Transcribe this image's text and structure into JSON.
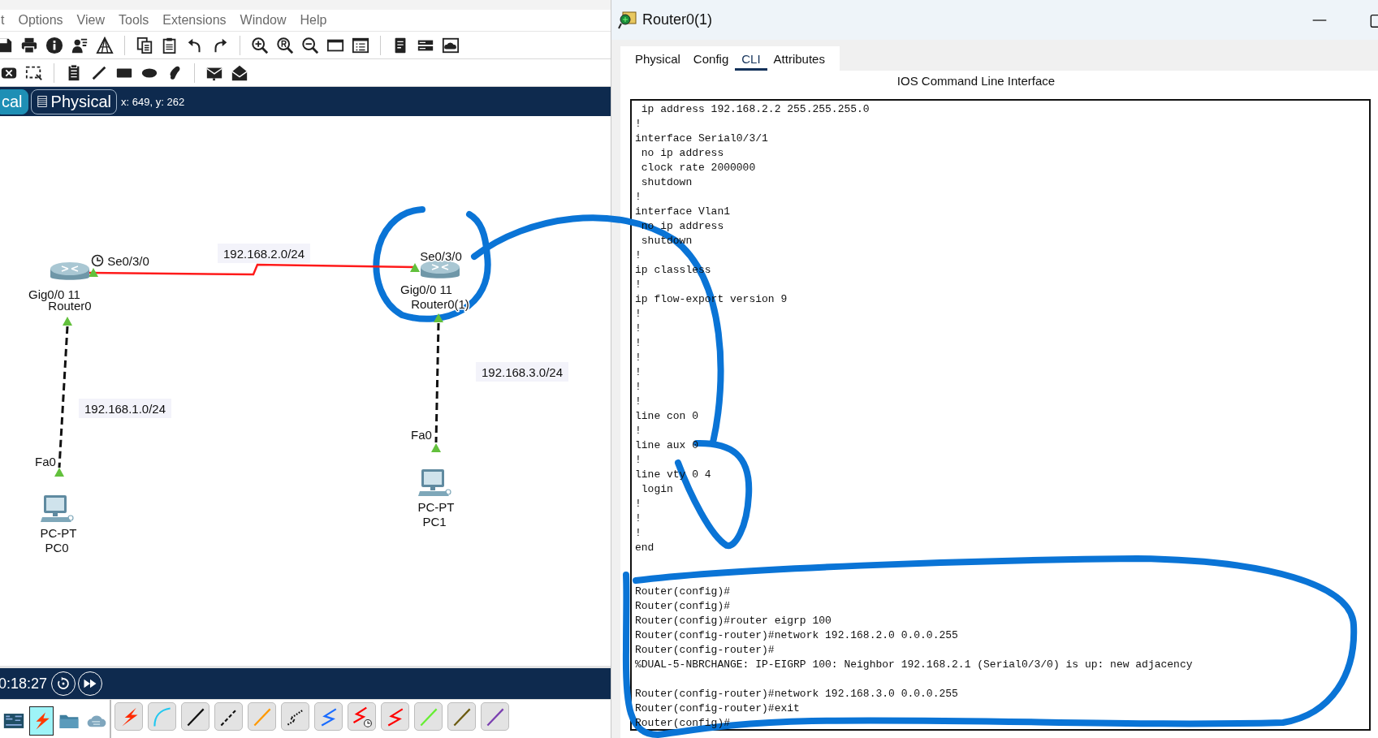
{
  "menu": [
    {
      "label": "t"
    },
    {
      "label": "Options"
    },
    {
      "label": "View"
    },
    {
      "label": "Tools"
    },
    {
      "label": "Extensions"
    },
    {
      "label": "Window"
    },
    {
      "label": "Help"
    }
  ],
  "view_tabs": [
    {
      "label": "cal",
      "selected": true
    },
    {
      "label": "Physical",
      "selected": false
    }
  ],
  "coordinates": "x: 649, y: 262",
  "canvas": {
    "devices": [
      {
        "kind": "router",
        "name": "Router0"
      },
      {
        "kind": "router",
        "name": "Router0(1)"
      },
      {
        "kind": "pc",
        "model": "PC-PT",
        "name": "PC0"
      },
      {
        "kind": "pc",
        "model": "PC-PT",
        "name": "PC1"
      }
    ],
    "links": [
      {
        "kind": "serial",
        "network": "192.168.2.0/24",
        "ports": [
          "Se0/3/0",
          "Se0/3/0"
        ],
        "clock": true
      },
      {
        "kind": "copper",
        "network": "192.168.1.0/24",
        "ports": [
          "Gig0/0 11",
          "Fa0"
        ],
        "clock": false
      },
      {
        "kind": "copper",
        "network": "192.168.3.0/24",
        "ports": [
          "Gig0/0 11",
          "Fa0"
        ],
        "clock": false
      }
    ]
  },
  "simulation_time": "0:18:27",
  "device_categories": [
    {
      "kind": "board",
      "selected": false
    },
    {
      "kind": "connections",
      "selected": true
    },
    {
      "kind": "folder",
      "selected": false
    },
    {
      "kind": "cloud",
      "selected": false
    }
  ],
  "cables": [
    {
      "kind": "lightning",
      "color": "#ff2a00"
    },
    {
      "kind": "curve",
      "color": "#22c8f0"
    },
    {
      "kind": "line",
      "color": "#111111"
    },
    {
      "kind": "dashed",
      "color": "#111111"
    },
    {
      "kind": "line",
      "color": "#ff9900"
    },
    {
      "kind": "dotted-zigzag",
      "color": "#111111"
    },
    {
      "kind": "zigzag",
      "color": "#1a6cff"
    },
    {
      "kind": "zigzag-clock",
      "color": "#ff0000"
    },
    {
      "kind": "zigzag",
      "color": "#ff0000"
    },
    {
      "kind": "line",
      "color": "#66ee33"
    },
    {
      "kind": "line",
      "color": "#6b5a10"
    },
    {
      "kind": "line",
      "color": "#7a3fb0"
    }
  ],
  "router_window": {
    "title": "Router0(1)",
    "tabs": [
      {
        "label": "Physical",
        "selected": false
      },
      {
        "label": "Config",
        "selected": false
      },
      {
        "label": "CLI",
        "selected": true
      },
      {
        "label": "Attributes",
        "selected": false
      }
    ],
    "heading": "IOS Command Line Interface",
    "terminal": [
      {
        "text": " ip address 192.168.2.2 255.255.255.0"
      },
      {
        "text": "!"
      },
      {
        "text": "interface Serial0/3/1"
      },
      {
        "text": " no ip address"
      },
      {
        "text": " clock rate 2000000"
      },
      {
        "text": " shutdown"
      },
      {
        "text": "!"
      },
      {
        "text": "interface Vlan1"
      },
      {
        "text": " no ip address"
      },
      {
        "text": " shutdown"
      },
      {
        "text": "!"
      },
      {
        "text": "ip classless"
      },
      {
        "text": "!"
      },
      {
        "text": "ip flow-export version 9"
      },
      {
        "text": "!"
      },
      {
        "text": "!"
      },
      {
        "text": "!"
      },
      {
        "text": "!"
      },
      {
        "text": "!"
      },
      {
        "text": "!"
      },
      {
        "text": "!"
      },
      {
        "text": "line con 0"
      },
      {
        "text": "!"
      },
      {
        "text": "line aux 0"
      },
      {
        "text": "!"
      },
      {
        "text": "line vty 0 4"
      },
      {
        "text": " login"
      },
      {
        "text": "!"
      },
      {
        "text": "!"
      },
      {
        "text": "!"
      },
      {
        "text": "end"
      },
      {
        "kind": "blank"
      },
      {
        "kind": "blank"
      },
      {
        "text": "Router(config)#"
      },
      {
        "text": "Router(config)#"
      },
      {
        "text": "Router(config)#router eigrp 100"
      },
      {
        "text": "Router(config-router)#network 192.168.2.0 0.0.0.255"
      },
      {
        "text": "Router(config-router)#"
      },
      {
        "text": "%DUAL-5-NBRCHANGE: IP-EIGRP 100: Neighbor 192.168.2.1 (Serial0/3/0) is up: new adjacency"
      },
      {
        "kind": "blank"
      },
      {
        "text": "Router(config-router)#network 192.168.3.0 0.0.0.255"
      },
      {
        "text": "Router(config-router)#exit"
      },
      {
        "text": "Router(config)#"
      }
    ]
  }
}
